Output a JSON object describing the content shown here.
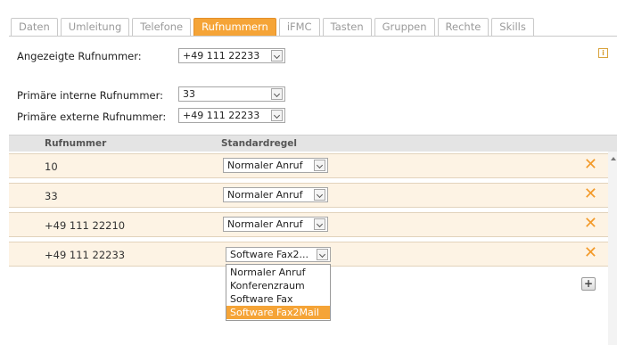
{
  "tabs": [
    {
      "label": "Daten"
    },
    {
      "label": "Umleitung"
    },
    {
      "label": "Telefone"
    },
    {
      "label": "Rufnummern"
    },
    {
      "label": "iFMC"
    },
    {
      "label": "Tasten"
    },
    {
      "label": "Gruppen"
    },
    {
      "label": "Rechte"
    },
    {
      "label": "Skills"
    }
  ],
  "active_tab": "Rufnummern",
  "displayed_number": {
    "label": "Angezeigte Rufnummer:",
    "value": "+49 111 22233"
  },
  "primary_internal": {
    "label": "Primäre interne Rufnummer:",
    "value": "33"
  },
  "primary_external": {
    "label": "Primäre externe Rufnummer:",
    "value": "+49 111 22233"
  },
  "info_icon": "i",
  "grid": {
    "headers": {
      "number": "Rufnummer",
      "rule": "Standardregel"
    },
    "rows": [
      {
        "number": "10",
        "rule": "Normaler Anruf"
      },
      {
        "number": "33",
        "rule": "Normaler Anruf"
      },
      {
        "number": "+49 111 22210",
        "rule": "Normaler Anruf"
      },
      {
        "number": "+49 111 22233",
        "rule": "Software Fax2..."
      }
    ],
    "delete_symbol": "✕"
  },
  "dropdown": {
    "options": [
      "Normaler Anruf",
      "Konferenzraum",
      "Software Fax",
      "Software Fax2Mail"
    ],
    "highlighted": "Software Fax2Mail"
  },
  "add_button": "+",
  "colors": {
    "accent": "#f5a437",
    "row_bg": "#fdf3e4",
    "delete": "#f39a2a"
  }
}
